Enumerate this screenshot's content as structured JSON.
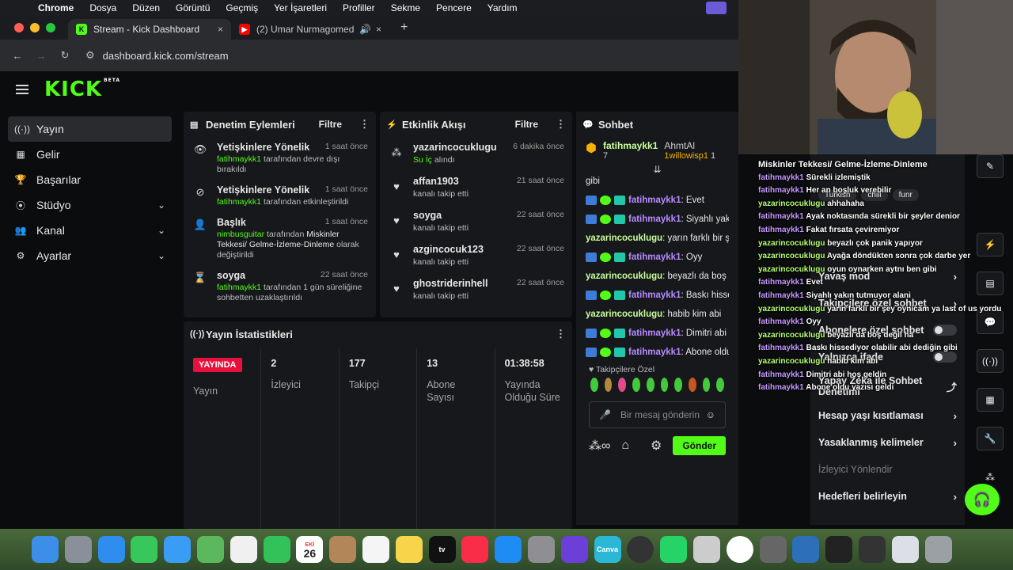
{
  "menubar": {
    "app": "Chrome",
    "items": [
      "Dosya",
      "Düzen",
      "Görüntü",
      "Geçmiş",
      "Yer İşaretleri",
      "Profiller",
      "Sekme",
      "Pencere",
      "Yardım"
    ]
  },
  "browser": {
    "tabs": [
      {
        "title": "Stream - Kick Dashboard",
        "close": "×"
      },
      {
        "title": "(2) Umar Nurmagomedov",
        "close": "×"
      }
    ],
    "new_tab": "+",
    "url": "dashboard.kick.com/stream"
  },
  "brand": {
    "logo": "KICK",
    "beta": "BETA",
    "accent": "#53fc18"
  },
  "sidebar": {
    "items": [
      {
        "label": "Yayın",
        "icon": "broadcast-icon"
      },
      {
        "label": "Gelir",
        "icon": "chart-icon"
      },
      {
        "label": "Başarılar",
        "icon": "trophy-icon"
      },
      {
        "label": "Stüdyo",
        "icon": "studio-icon"
      },
      {
        "label": "Kanal",
        "icon": "users-icon"
      },
      {
        "label": "Ayarlar",
        "icon": "gear-icon"
      }
    ]
  },
  "moderation": {
    "title": "Denetim Eylemleri",
    "filter": "Filtre",
    "items": [
      {
        "title": "Yetişkinlere Yönelik",
        "time": "1 saat önce",
        "user": "fatihmaykk1",
        "rest": " tarafından devre dışı bırakıldı"
      },
      {
        "title": "Yetişkinlere Yönelik",
        "time": "1 saat önce",
        "user": "fatihmaykk1",
        "rest": " tarafından etkinleştirildi"
      },
      {
        "title": "Başlık",
        "time": "1 saat önce",
        "user": "nimbusguitar",
        "rest": " tarafından ",
        "bold": "Miskinler Tekkesi/ Gelme-İzleme-Dinleme",
        "rest2": " olarak değiştirildi"
      },
      {
        "title": "soyga",
        "time": "22 saat önce",
        "user": "fatihmaykk1",
        "rest": " tarafından 1 gün süreliğine sohbetten uzaklaştırıldı"
      }
    ]
  },
  "activity": {
    "title": "Etkinlik Akışı",
    "filter": "Filtre",
    "items": [
      {
        "user": "yazarincocuklugu",
        "time": "6 dakika önce",
        "highlight": "Su İç",
        "sub": " alındı"
      },
      {
        "user": "affan1903",
        "time": "21 saat önce",
        "sub": "kanalı takip etti"
      },
      {
        "user": "soyga",
        "time": "22 saat önce",
        "sub": "kanalı takip etti"
      },
      {
        "user": "azgincocuk123",
        "time": "22 saat önce",
        "sub": "kanalı takip etti"
      },
      {
        "user": "ghostriderinhell",
        "time": "22 saat önce",
        "sub": "kanalı takip etti"
      }
    ]
  },
  "stats": {
    "title": "Yayın İstatistikleri",
    "live": "YAYINDA",
    "cols": [
      {
        "value": "",
        "label": "Yayın"
      },
      {
        "value": "2",
        "label": "İzleyici"
      },
      {
        "value": "177",
        "label": "Takipçi"
      },
      {
        "value": "13",
        "label": "Abone Sayısı"
      },
      {
        "value": "01:38:58",
        "label": "Yayında Olduğu Süre"
      }
    ]
  },
  "chat": {
    "title": "Sohbet",
    "pinned": [
      {
        "name": "fatihmaykk1",
        "count": "7"
      },
      {
        "name": "AhmtAl",
        "count": ""
      },
      {
        "name": "1willowisp1",
        "count": "1"
      }
    ],
    "lines": [
      {
        "user": "",
        "text": "gibi"
      },
      {
        "user": "fatihmaykk1",
        "text": "Evet"
      },
      {
        "user": "fatihmaykk1",
        "text": "Siyahlı yakın tutmuyor alani"
      },
      {
        "user": "yazarincocuklugu",
        "text": "yarın farklı bir şey oyn... ya last of us yordu"
      },
      {
        "user": "fatihmaykk1",
        "text": "Oyy"
      },
      {
        "user": "yazarincocuklugu",
        "text": "beyazlı da boş değil ha"
      },
      {
        "user": "fatihmaykk1",
        "text": "Baskı hissediyor olabilir abi dediğin gibi"
      },
      {
        "user": "yazarincocuklugu",
        "text": "habib kim abi"
      },
      {
        "user": "fatihmaykk1",
        "text": "Dimitri abi hoş geldin"
      },
      {
        "user": "fatihmaykk1",
        "text": "Abone oldu yazısı geldi"
      }
    ],
    "emote_header": "Takipçilere Özel",
    "placeholder": "Bir mesaj gönderin",
    "send": "Gönder"
  },
  "settings": {
    "items": [
      {
        "label": "Yavaş mod",
        "type": "chev"
      },
      {
        "label": "Takipçilere özel sohbet",
        "type": "chev"
      },
      {
        "label": "Abonelere özel sohbet",
        "type": "toggle"
      },
      {
        "label": "Yalnızca ifade",
        "type": "toggle"
      },
      {
        "label": "Yapay Zeka ile Sohbet Denetimi",
        "type": "chart"
      },
      {
        "label": "Hesap yaşı kısıtlaması",
        "type": "chev"
      },
      {
        "label": "Yasaklanmış kelimeler",
        "type": "chev"
      },
      {
        "label": "İzleyici Yönlendir",
        "type": "muted"
      },
      {
        "label": "Hedefleri belirleyin",
        "type": "chev"
      }
    ],
    "tags": [
      "Turkish",
      "chill",
      "funr"
    ],
    "title_partial": "Miskinler Tekkesi/ Gelme-İzleme-Dinleme"
  },
  "overlay_chat": [
    {
      "user": "fatihmaykk1",
      "text": "Sürekli izlemiştik"
    },
    {
      "user": "fatihmaykk1",
      "text": "Her an boşluk verebilir"
    },
    {
      "user": "yazarincocuklugu",
      "text": "ahhahaha"
    },
    {
      "user": "fatihmaykk1",
      "text": "Ayak noktasında sürekli bir şeyler denior"
    },
    {
      "user": "fatihmaykk1",
      "text": "Fakat fırsata çeviremiyor"
    },
    {
      "user": "yazarincocuklugu",
      "text": "beyazlı çok panik yapıyor"
    },
    {
      "user": "yazarincocuklugu",
      "text": "Ayağa döndükten sonra çok darbe yer"
    },
    {
      "user": "yazarincocuklugu",
      "text": "oyun oynarken aytnı ben gibi"
    },
    {
      "user": "fatihmaykk1",
      "text": "Evet"
    },
    {
      "user": "fatihmaykk1",
      "text": "Siyahlı yakın tutmuyor alani"
    },
    {
      "user": "yazarincocuklugu",
      "text": "yarın farklı bir şey oynicam ya last of us yordu"
    },
    {
      "user": "fatihmaykk1",
      "text": "Oyy"
    },
    {
      "user": "yazarincocuklugu",
      "text": "beyazlı da boş değil ha"
    },
    {
      "user": "fatihmaykk1",
      "text": "Baskı hissediyor olabilir abi dediğin gibi"
    },
    {
      "user": "yazarincocuklugu",
      "text": "habib kim abi"
    },
    {
      "user": "fatihmaykk1",
      "text": "Dimitri abi hoş geldin"
    },
    {
      "user": "fatihmaykk1",
      "text": "Abone oldu yazısı geldi"
    }
  ],
  "dock": {
    "calendar_month": "EKİ",
    "calendar_day": "26",
    "items": [
      "finder",
      "launchpad",
      "safari",
      "messages",
      "mail",
      "maps",
      "photos",
      "facetime",
      "calendar",
      "contacts",
      "reminders",
      "notes",
      "tv",
      "music",
      "appstore",
      "settings",
      "imovie",
      "canva",
      "obs",
      "whatsapp",
      "disk",
      "chrome",
      "calculator",
      "quicktime",
      "ghub",
      "game",
      "preview",
      "trash"
    ],
    "tv_label": "tv",
    "canva_label": "Canva"
  }
}
